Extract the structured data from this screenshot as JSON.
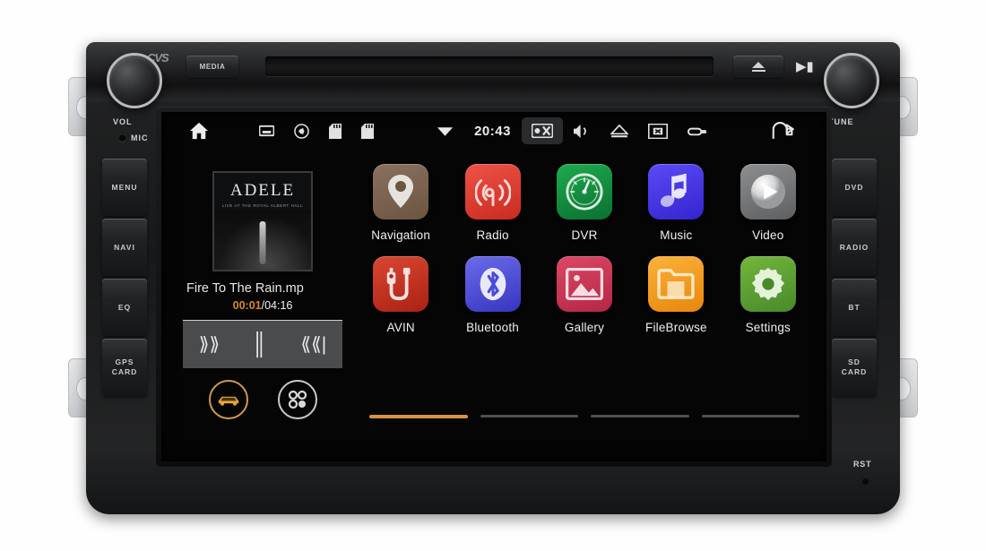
{
  "device": {
    "top_controls": {
      "logo": "CVS",
      "media_button": "MEDIA",
      "volume_knob_label": "VOL",
      "tune_knob_label": "TUNE",
      "mic_label": "MIC",
      "reset_label": "RST"
    },
    "left_keys": [
      {
        "label": "MENU",
        "name": "menu"
      },
      {
        "label": "NAVI",
        "name": "navi"
      },
      {
        "label": "EQ",
        "name": "eq"
      },
      {
        "label": "GPS\nCARD",
        "name": "gps-card"
      }
    ],
    "right_keys": [
      {
        "label": "DVD",
        "name": "dvd"
      },
      {
        "label": "RADIO",
        "name": "radio"
      },
      {
        "label": "BT",
        "name": "bt"
      },
      {
        "label": "SD\nCARD",
        "name": "sd-card"
      }
    ]
  },
  "screen": {
    "statusbar": {
      "home_icon": "home-icon",
      "left_icons": [
        "sd-slot-icon",
        "record-icon",
        "sd-card-icon",
        "sd-card-icon"
      ],
      "wifi_icon": "wifi-icon",
      "clock": "20:43",
      "right_icons": [
        "camera-icon",
        "mute-icon",
        "eject-icon",
        "screen-off-icon",
        "usb-icon"
      ],
      "back_icon": "back-icon"
    },
    "music_widget": {
      "album_title": "ADELE",
      "album_subtitle": "LIVE AT THE ROYAL ALBERT HALL",
      "track_name": "Fire To The Rain.mp",
      "elapsed": "00:01",
      "duration": "/04:16",
      "prev_icon": "previous-track-icon",
      "play_pause_icon": "pause-icon",
      "next_icon": "next-track-icon",
      "quick_car_icon": "car-icon",
      "quick_apps_icon": "app-drawer-icon"
    },
    "apps": [
      {
        "label": "Navigation",
        "icon": "map-pin-icon",
        "color": "#7b6352"
      },
      {
        "label": "Radio",
        "icon": "broadcast-icon",
        "color": "#e03a2f"
      },
      {
        "label": "DVR",
        "icon": "gauge-icon",
        "color": "#12903f"
      },
      {
        "label": "Music",
        "icon": "music-note-icon",
        "color": "#4334e8"
      },
      {
        "label": "Video",
        "icon": "play-circle-icon",
        "color": "#78797b"
      },
      {
        "label": "AVIN",
        "icon": "av-plug-icon",
        "color": "#c9341f"
      },
      {
        "label": "Bluetooth",
        "icon": "bluetooth-icon",
        "color": "#4a4bd6"
      },
      {
        "label": "Gallery",
        "icon": "photo-icon",
        "color": "#cc3354"
      },
      {
        "label": "FileBrowse",
        "icon": "folder-icon",
        "color": "#f09a1c"
      },
      {
        "label": "Settings",
        "icon": "gear-icon",
        "color": "#5d9e2f"
      }
    ],
    "pager": {
      "pages": 4,
      "active": 1,
      "active_color": "#d9933f"
    }
  }
}
